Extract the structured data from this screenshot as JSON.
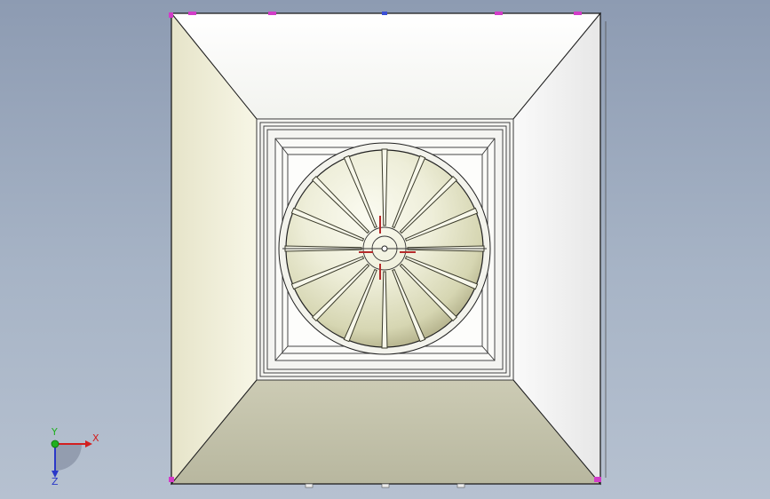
{
  "triad": {
    "x_label": "X",
    "y_label": "Y",
    "z_label": "Z",
    "colors": {
      "x": "#d21f1f",
      "y": "#1fb01f",
      "z": "#2a38c8"
    }
  },
  "palette": {
    "background_top": "#8d9bb2",
    "background_bottom": "#b6c1d0",
    "marker": "#d23cc8"
  }
}
